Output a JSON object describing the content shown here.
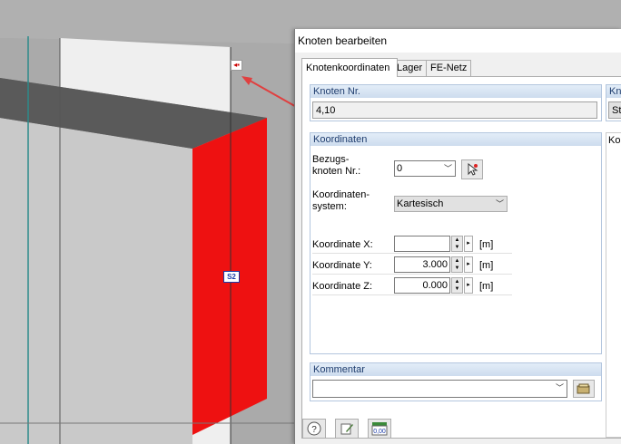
{
  "viewport": {
    "node_marker_icon": "node-marker-icon",
    "surface_label": "S2",
    "colors": {
      "surface": "#ee1111",
      "background": "#a9a9a9"
    }
  },
  "dialog": {
    "title": "Knoten bearbeiten",
    "tabs": [
      {
        "label": "Knotenkoordinaten",
        "active": true
      },
      {
        "label": "Lager",
        "active": false
      },
      {
        "label": "FE-Netz",
        "active": false
      }
    ],
    "node_no": {
      "header": "Knoten Nr.",
      "value": "4,10"
    },
    "right_group": {
      "header_partial": "Kno",
      "button_partial": "Sta"
    },
    "preview_header_partial": "Ko",
    "coordinates": {
      "header": "Koordinaten",
      "ref_node_label_1": "Bezugs-",
      "ref_node_label_2": "knoten Nr.:",
      "ref_node_value": "0",
      "system_label_1": "Koordinaten-",
      "system_label_2": "system:",
      "system_value": "Kartesisch",
      "x": {
        "label": "Koordinate X:",
        "value": "",
        "unit": "[m]"
      },
      "y": {
        "label": "Koordinate Y:",
        "value": "3.000",
        "unit": "[m]"
      },
      "z": {
        "label": "Koordinate Z:",
        "value": "0.000",
        "unit": "[m]"
      }
    },
    "comment": {
      "header": "Kommentar",
      "value": ""
    },
    "bottom_icons": [
      "help-icon",
      "edit-icon",
      "number-format-icon"
    ],
    "bottom_icon_text": "0,00"
  }
}
